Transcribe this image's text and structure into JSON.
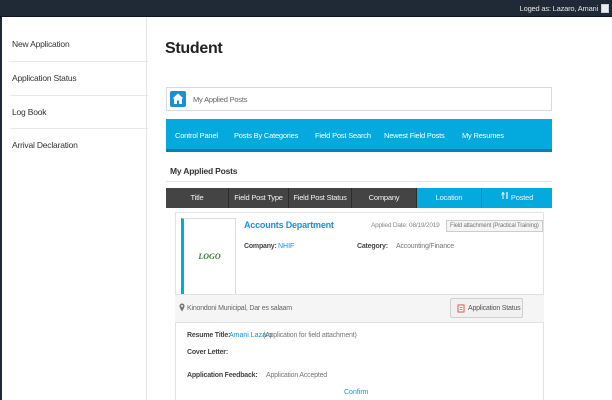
{
  "topbar": {
    "login_text": "Loged as: Lazaro, Amani"
  },
  "sidebar": {
    "items": [
      {
        "label": "New Application"
      },
      {
        "label": "Application Status"
      },
      {
        "label": "Log Book"
      },
      {
        "label": "Arrival Declaration"
      }
    ]
  },
  "page": {
    "title": "Student"
  },
  "breadcrumb": {
    "text": "My Applied Posts"
  },
  "nav": {
    "items": [
      {
        "label": "Control Panel"
      },
      {
        "label": "Posts By Categories"
      },
      {
        "label": "Field Post Search"
      },
      {
        "label": "Newest Field Posts"
      },
      {
        "label": "My Resumes"
      }
    ]
  },
  "section": {
    "heading": "My Applied Posts"
  },
  "table": {
    "columns": [
      {
        "label": "Title"
      },
      {
        "label": "Field Post Type"
      },
      {
        "label": "Field Post Status"
      },
      {
        "label": "Company"
      },
      {
        "label": "Location"
      },
      {
        "label": "Posted"
      }
    ]
  },
  "post": {
    "logo_text": "LOGO",
    "department": "Accounts Department",
    "applied_date": "Applied Date: 08/19/2019",
    "type_badge": "Field attachment (Practical Training)",
    "company_label": "Company:",
    "company_value": "NHIF",
    "category_label": "Category:",
    "category_value": "Accounting/Finance",
    "location": "Kinondoni Municipal, Dar es salaam",
    "status_button": "Application Status",
    "resume_label": "Resume Title:",
    "resume_name": "Amani Lazaro",
    "resume_desc": "(Application for field attachment)",
    "cover_label": "Cover Letter:",
    "feedback_label": "Application Feedback:",
    "feedback_value": "Application Accepted",
    "confirm": "Confirm"
  },
  "colors": {
    "accent": "#04a9de",
    "topbar": "#1f2a36",
    "link": "#1b8fd6",
    "table_header": "#444444"
  },
  "icons": [
    "home-icon",
    "location-pin-icon",
    "status-icon",
    "sort-arrow-icon",
    "user-icon"
  ]
}
